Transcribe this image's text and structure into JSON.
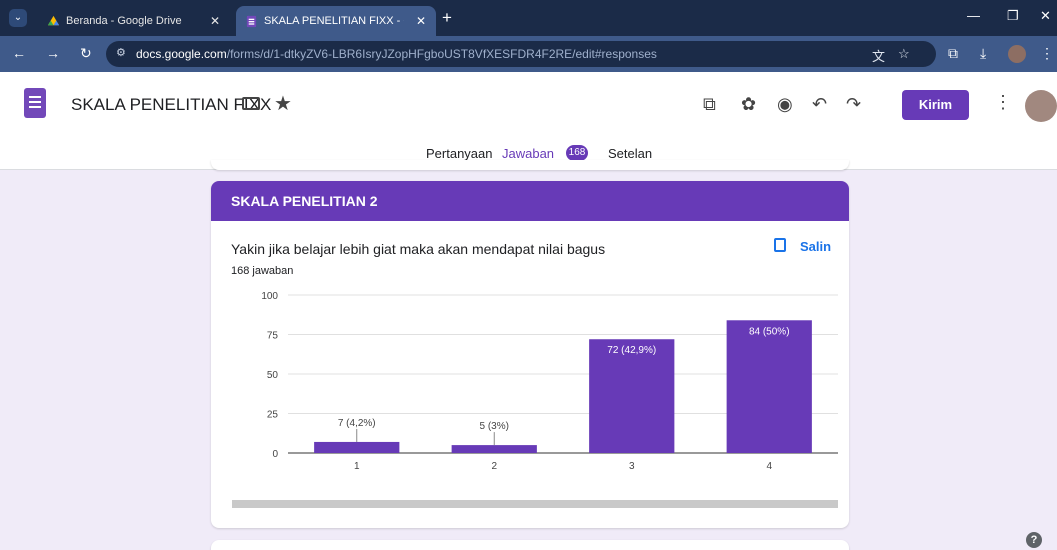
{
  "browser": {
    "tabs": [
      {
        "title": "Beranda - Google Drive",
        "icon": "google-drive-icon",
        "active": false
      },
      {
        "title": "SKALA PENELITIAN FIXX - Goog",
        "icon": "google-forms-icon",
        "active": true
      }
    ],
    "url_domain": "docs.google.com",
    "url_path": "/forms/d/1-dtkyZV6-LBR6IsryJZopHFgboUST8VfXESFDR4F2RE/edit#responses"
  },
  "form": {
    "title": "SKALA PENELITIAN FIXX",
    "send_label": "Kirim",
    "tabs": {
      "questions": "Pertanyaan",
      "responses": "Jawaban",
      "responses_count": "168",
      "settings": "Setelan"
    }
  },
  "section": {
    "title": "SKALA PENELITIAN 2",
    "question": "Yakin jika belajar lebih giat maka akan mendapat nilai bagus",
    "copy_label": "Salin",
    "response_count_text": "168 jawaban"
  },
  "colors": {
    "accent": "#673ab7",
    "background": "#f0ebf8",
    "link": "#1a73e8"
  },
  "chart_data": {
    "type": "bar",
    "categories": [
      "1",
      "2",
      "3",
      "4"
    ],
    "values": [
      7,
      5,
      72,
      84
    ],
    "labels": [
      "7 (4,2%)",
      "5 (3%)",
      "72 (42,9%)",
      "84 (50%)"
    ],
    "yticks": [
      "0",
      "25",
      "50",
      "75",
      "100"
    ],
    "ylim": [
      0,
      100
    ],
    "bar_color": "#673ab7",
    "grid": true
  }
}
